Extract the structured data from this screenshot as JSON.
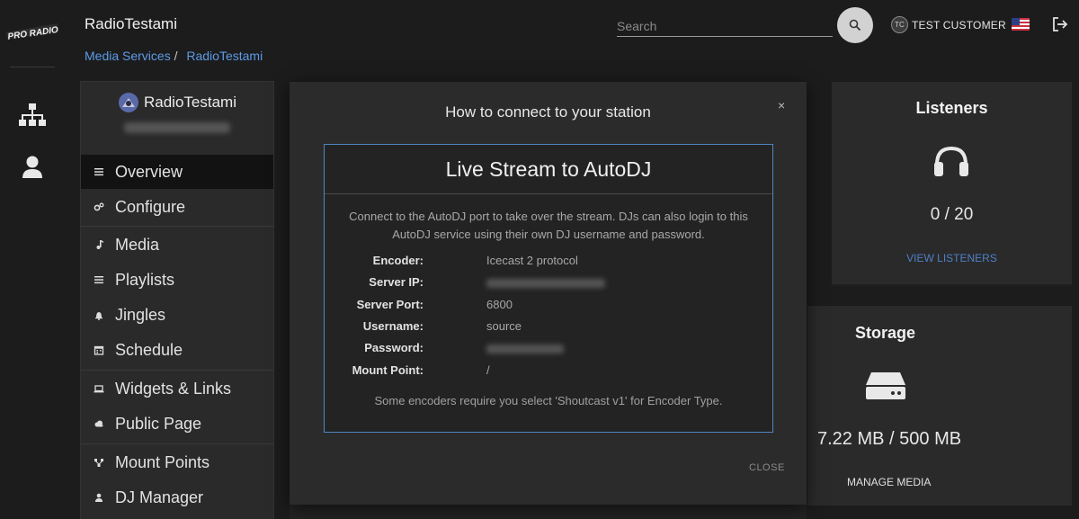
{
  "brand": {
    "logo_text": "PRO RADIO"
  },
  "header": {
    "station_title": "RadioTestami",
    "breadcrumb": {
      "parent": "Media Services",
      "separator": "/",
      "current": "RadioTestami"
    },
    "search_placeholder": "Search",
    "user_initials": "TC",
    "user_name": "TEST CUSTOMER"
  },
  "sidebar": {
    "station_name": "RadioTestami",
    "items": [
      {
        "label": "Overview",
        "icon": "list-icon",
        "active": true
      },
      {
        "label": "Configure",
        "icon": "cogs-icon"
      },
      {
        "label": "Media",
        "icon": "music-note-icon"
      },
      {
        "label": "Playlists",
        "icon": "list-icon"
      },
      {
        "label": "Jingles",
        "icon": "bell-icon"
      },
      {
        "label": "Schedule",
        "icon": "calendar-icon"
      },
      {
        "label": "Widgets & Links",
        "icon": "laptop-icon"
      },
      {
        "label": "Public Page",
        "icon": "cloud-icon"
      },
      {
        "label": "Mount Points",
        "icon": "network-icon"
      },
      {
        "label": "DJ Manager",
        "icon": "person-icon"
      }
    ]
  },
  "listeners_card": {
    "title": "Listeners",
    "value": "0 / 20",
    "link": "VIEW LISTENERS",
    "icon": "headphones-icon"
  },
  "storage_card": {
    "title": "Storage",
    "value": "7.22 MB / 500 MB",
    "link": "MANAGE MEDIA",
    "icon": "hard-drive-icon"
  },
  "modal": {
    "title": "How to connect to your station",
    "close_symbol": "×",
    "section_title": "Live Stream to AutoDJ",
    "description": "Connect to the AutoDJ port to take over the stream. DJs can also login to this AutoDJ service using their own DJ username and password.",
    "rows": [
      {
        "label": "Encoder:",
        "value": "Icecast 2 protocol"
      },
      {
        "label": "Server IP:",
        "value": ""
      },
      {
        "label": "Server Port:",
        "value": "6800"
      },
      {
        "label": "Username:",
        "value": "source"
      },
      {
        "label": "Password:",
        "value": ""
      },
      {
        "label": "Mount Point:",
        "value": "/"
      }
    ],
    "note": "Some encoders require you select 'Shoutcast v1' for Encoder Type.",
    "close_button": "CLOSE"
  },
  "colors": {
    "accent_blue": "#5c9be6",
    "link_blue": "#4f7fc4",
    "modal_border": "#4f86c0"
  }
}
